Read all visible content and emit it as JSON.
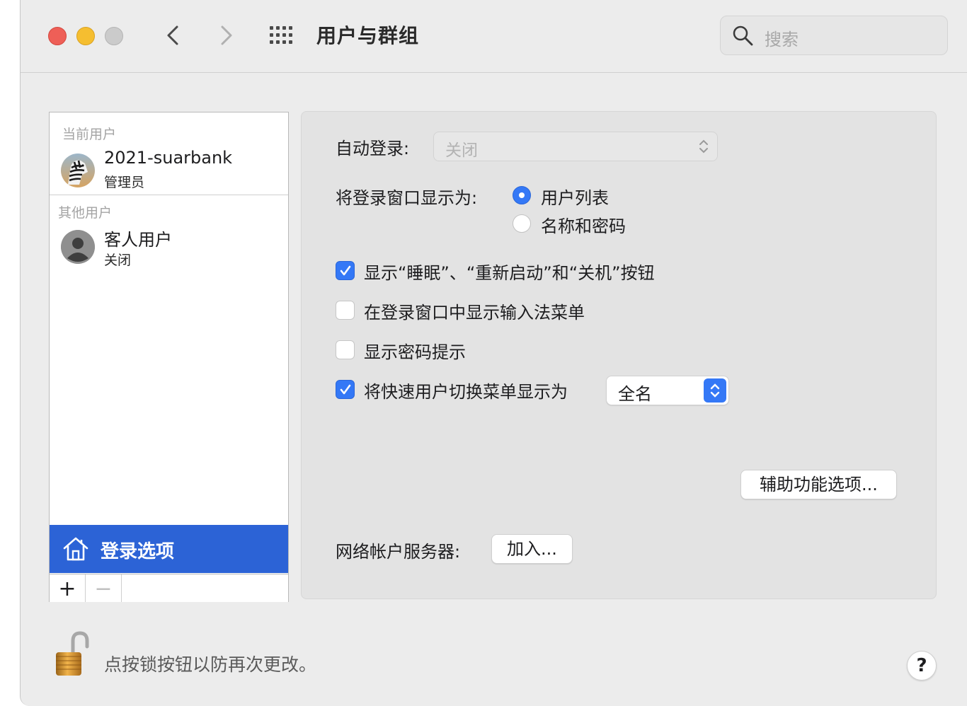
{
  "window": {
    "title": "用户与群组",
    "search_placeholder": "搜索"
  },
  "user_list": {
    "current_header": "当前用户",
    "current_user": {
      "name": "2021-suarbank",
      "role": "管理员"
    },
    "other_header": "其他用户",
    "guest_user": {
      "name": "客人用户",
      "status": "关闭"
    },
    "login_options_label": "登录选项",
    "add_glyph": "+",
    "remove_glyph": "−"
  },
  "settings": {
    "auto_login_label": "自动登录:",
    "auto_login_value": "关闭",
    "display_login_as_label": "将登录窗口显示为:",
    "radio_options": [
      {
        "label": "用户列表",
        "selected": true
      },
      {
        "label": "名称和密码",
        "selected": false
      }
    ],
    "checkboxes": [
      {
        "label": "显示“睡眠”、“重新启动”和“关机”按钮",
        "checked": true
      },
      {
        "label": "在登录窗口中显示输入法菜单",
        "checked": false
      },
      {
        "label": "显示密码提示",
        "checked": false
      },
      {
        "label": "将快速用户切换菜单显示为",
        "checked": true
      }
    ],
    "fast_switch_value": "全名",
    "accessibility_button": "辅助功能选项...",
    "network_server_label": "网络帐户服务器:",
    "join_button": "加入..."
  },
  "footer": {
    "lock_message": "点按锁按钮以防再次更改。",
    "help_glyph": "?"
  },
  "colors": {
    "accent": "#3478f6",
    "selection": "#2c63d6",
    "close": "#ee5f57",
    "minimize": "#f5be30",
    "zoom": "#cbcbcb"
  }
}
